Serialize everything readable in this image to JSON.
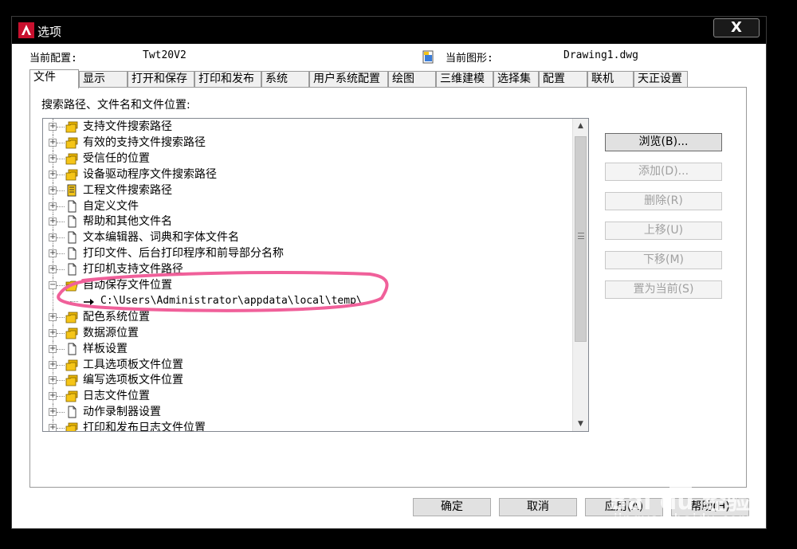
{
  "window": {
    "title": "选项",
    "close_label": "X"
  },
  "profile": {
    "current_profile_label": "当前配置:",
    "current_profile_value": "Twt20V2",
    "current_drawing_label": "当前图形:",
    "current_drawing_value": "Drawing1.dwg"
  },
  "tabs": [
    {
      "label": "文件",
      "active": true
    },
    {
      "label": "显示"
    },
    {
      "label": "打开和保存"
    },
    {
      "label": "打印和发布"
    },
    {
      "label": "系统"
    },
    {
      "label": "用户系统配置"
    },
    {
      "label": "绘图"
    },
    {
      "label": "三维建模"
    },
    {
      "label": "选择集"
    },
    {
      "label": "配置"
    },
    {
      "label": "联机"
    },
    {
      "label": "天正设置"
    }
  ],
  "panel": {
    "caption": "搜索路径、文件名和文件位置:"
  },
  "tree": {
    "items": [
      {
        "label": "支持文件搜索路径",
        "icon": "folder-group-icon"
      },
      {
        "label": "有效的支持文件搜索路径",
        "icon": "folder-group-icon"
      },
      {
        "label": "受信任的位置",
        "icon": "folder-group-icon"
      },
      {
        "label": "设备驱动程序文件搜索路径",
        "icon": "folder-group-icon"
      },
      {
        "label": "工程文件搜索路径",
        "icon": "project-file-icon"
      },
      {
        "label": "自定义文件",
        "icon": "document-icon"
      },
      {
        "label": "帮助和其他文件名",
        "icon": "document-icon"
      },
      {
        "label": "文本编辑器、词典和字体文件名",
        "icon": "document-icon"
      },
      {
        "label": "打印文件、后台打印程序和前导部分名称",
        "icon": "document-icon"
      },
      {
        "label": "打印机支持文件路径",
        "icon": "document-icon"
      },
      {
        "label": "自动保存文件位置",
        "icon": "open-folder-icon",
        "expanded": true
      },
      {
        "label": "C:\\Users\\Administrator\\appdata\\local\\temp\\",
        "icon": "arrow-right-icon",
        "child": true
      },
      {
        "label": "配色系统位置",
        "icon": "folder-group-icon"
      },
      {
        "label": "数据源位置",
        "icon": "folder-group-icon"
      },
      {
        "label": "样板设置",
        "icon": "document-icon"
      },
      {
        "label": "工具选项板文件位置",
        "icon": "folder-group-icon"
      },
      {
        "label": "编写选项板文件位置",
        "icon": "folder-group-icon"
      },
      {
        "label": "日志文件位置",
        "icon": "folder-group-icon"
      },
      {
        "label": "动作录制器设置",
        "icon": "document-icon"
      },
      {
        "label": "打印和发布日志文件位置",
        "icon": "folder-group-icon"
      }
    ]
  },
  "side_buttons": {
    "browse": "浏览(B)...",
    "add": "添加(D)...",
    "remove": "删除(R)",
    "move_up": "上移(U)",
    "move_down": "下移(M)",
    "set_current": "置为当前(S)"
  },
  "bottom_buttons": {
    "ok": "确定",
    "cancel": "取消",
    "apply": "应用(A)",
    "help": "帮助(H)"
  },
  "watermark": {
    "logo_text": "Bai du 经验",
    "url": "jingyan.baidu.com"
  },
  "colors": {
    "annotation": "#f0609a",
    "folder": "#f5c518",
    "titlebar": "#000000"
  }
}
